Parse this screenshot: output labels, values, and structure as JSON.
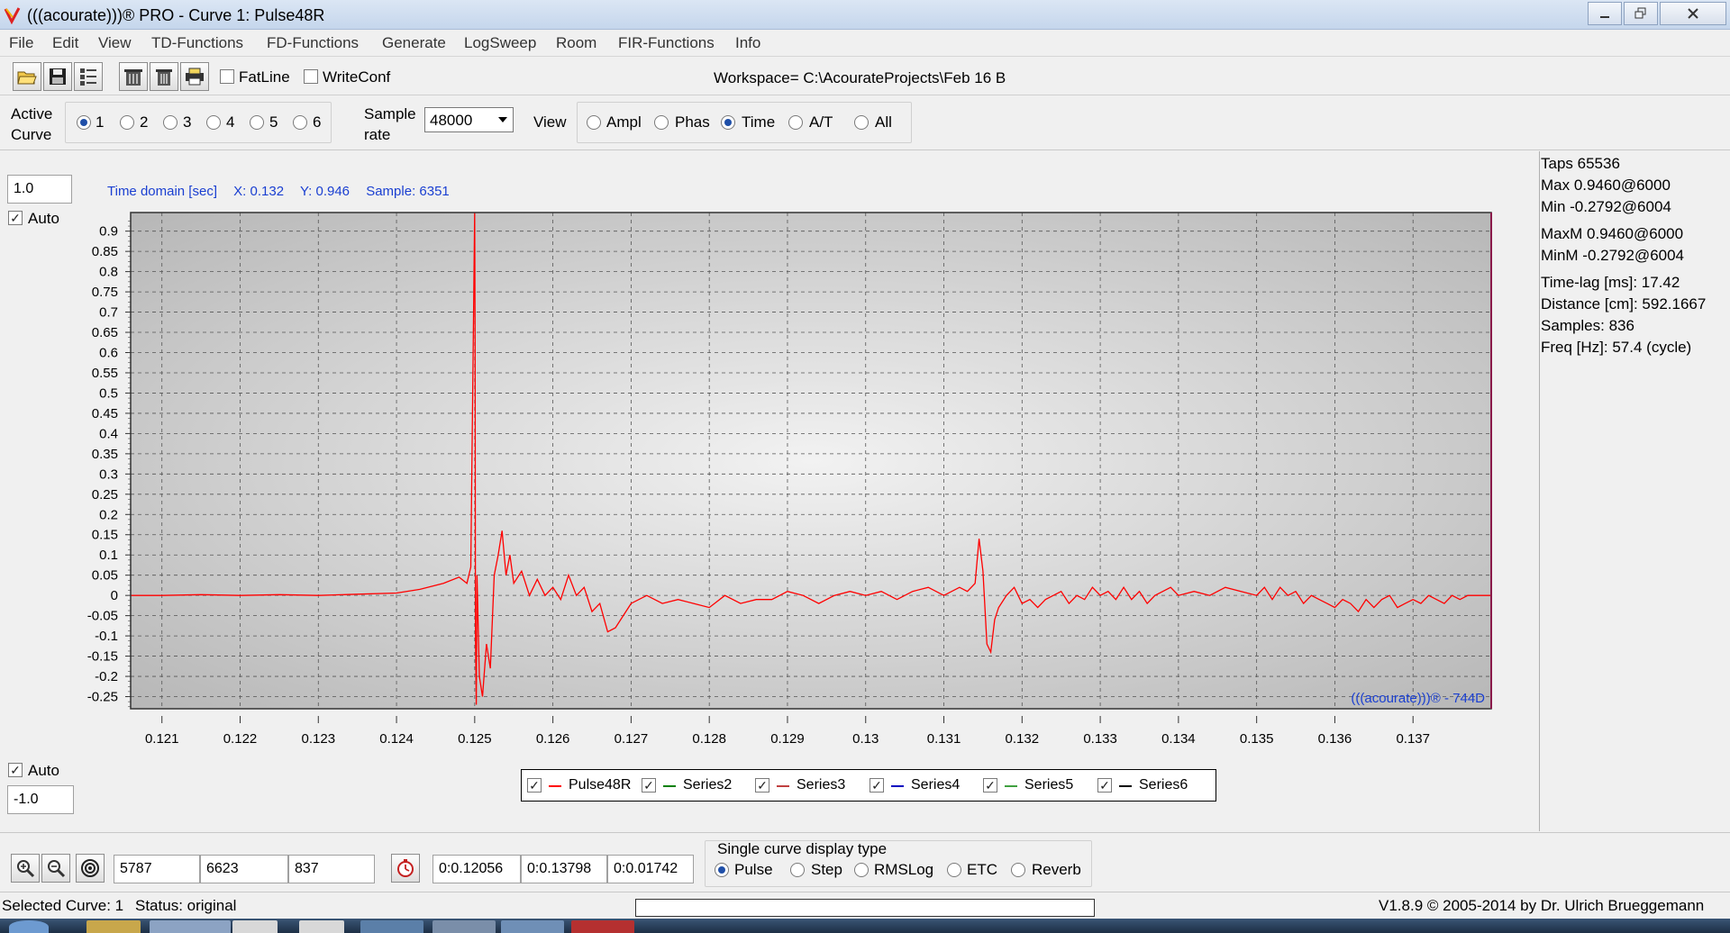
{
  "window": {
    "title": "(((acourate)))® PRO - Curve 1: Pulse48R"
  },
  "menu": [
    "File",
    "Edit",
    "View",
    "TD-Functions",
    "FD-Functions",
    "Generate",
    "LogSweep",
    "Room",
    "FIR-Functions",
    "Info"
  ],
  "toolbar": {
    "fatline_label": "FatLine",
    "writeconf_label": "WriteConf",
    "workspace": "Workspace=  C:\\AcourateProjects\\Feb 16 B"
  },
  "options": {
    "active_curve_label_1": "Active",
    "active_curve_label_2": "Curve",
    "curves": [
      "1",
      "2",
      "3",
      "4",
      "5",
      "6"
    ],
    "selected_curve": "1",
    "sample_rate_label_1": "Sample",
    "sample_rate_label_2": "rate",
    "sample_rate_value": "48000",
    "view_label": "View",
    "view_modes": [
      "Ampl",
      "Phas",
      "Time",
      "A/T",
      "All"
    ],
    "selected_view": "Time"
  },
  "chart_panel": {
    "ymax_input": "1.0",
    "ymin_input": "-1.0",
    "auto_label": "Auto",
    "header": {
      "domain": "Time domain [sec]",
      "x": "X: 0.132",
      "y": "Y: 0.946",
      "sample": "Sample: 6351"
    },
    "watermark": "(((acourate)))® - 744D"
  },
  "chart_data": {
    "type": "line",
    "title": "",
    "xlabel": "",
    "ylabel": "",
    "xlim": [
      0.1206,
      0.138
    ],
    "ylim": [
      -0.28,
      0.946
    ],
    "x_ticks": [
      "0.121",
      "0.122",
      "0.123",
      "0.124",
      "0.125",
      "0.126",
      "0.127",
      "0.128",
      "0.129",
      "0.13",
      "0.131",
      "0.132",
      "0.133",
      "0.134",
      "0.135",
      "0.136",
      "0.137"
    ],
    "y_ticks": [
      "0.9",
      "0.85",
      "0.8",
      "0.75",
      "0.7",
      "0.65",
      "0.6",
      "0.55",
      "0.5",
      "0.45",
      "0.4",
      "0.35",
      "0.3",
      "0.25",
      "0.2",
      "0.15",
      "0.1",
      "0.05",
      "0",
      "-0.05",
      "-0.1",
      "-0.15",
      "-0.2",
      "-0.25"
    ],
    "grid": true,
    "series": [
      {
        "name": "Pulse48R",
        "color": "#ff0000",
        "x": [
          0.1206,
          0.121,
          0.1215,
          0.122,
          0.1225,
          0.123,
          0.1235,
          0.124,
          0.1243,
          0.1246,
          0.1248,
          0.1249,
          0.12495,
          0.125,
          0.125005,
          0.12501,
          0.12502,
          0.12503,
          0.12506,
          0.1251,
          0.12515,
          0.1252,
          0.12525,
          0.1253,
          0.12535,
          0.1254,
          0.12545,
          0.1255,
          0.1256,
          0.1257,
          0.1258,
          0.1259,
          0.126,
          0.1261,
          0.1262,
          0.1263,
          0.1264,
          0.1265,
          0.1266,
          0.1267,
          0.1268,
          0.127,
          0.1272,
          0.1274,
          0.1276,
          0.1278,
          0.128,
          0.1282,
          0.1284,
          0.1286,
          0.1288,
          0.129,
          0.1292,
          0.1294,
          0.1296,
          0.1298,
          0.13,
          0.1302,
          0.1304,
          0.1306,
          0.1308,
          0.131,
          0.1312,
          0.1313,
          0.1314,
          0.13145,
          0.1315,
          0.13155,
          0.1316,
          0.13165,
          0.1317,
          0.1318,
          0.1319,
          0.132,
          0.1321,
          0.1322,
          0.1323,
          0.1324,
          0.1325,
          0.1326,
          0.1327,
          0.1328,
          0.1329,
          0.133,
          0.1331,
          0.1332,
          0.1333,
          0.1334,
          0.1335,
          0.1336,
          0.1337,
          0.1338,
          0.1339,
          0.134,
          0.1342,
          0.1344,
          0.1346,
          0.1348,
          0.135,
          0.1351,
          0.1352,
          0.1353,
          0.1354,
          0.1355,
          0.1356,
          0.1357,
          0.1358,
          0.1359,
          0.136,
          0.1361,
          0.1362,
          0.1363,
          0.1364,
          0.1365,
          0.1366,
          0.1367,
          0.1368,
          0.1369,
          0.137,
          0.1371,
          0.1372,
          0.1373,
          0.1374,
          0.1375,
          0.1376,
          0.1377,
          0.1378,
          0.138
        ],
        "y": [
          0,
          0.0,
          0.002,
          0.0,
          0.002,
          0.0,
          0.003,
          0.006,
          0.015,
          0.03,
          0.045,
          0.03,
          0.07,
          0.946,
          0.62,
          -0.1,
          -0.27,
          0.05,
          -0.2,
          -0.25,
          -0.12,
          -0.18,
          0.05,
          0.1,
          0.16,
          0.05,
          0.1,
          0.03,
          0.06,
          0.0,
          0.04,
          0.0,
          0.02,
          -0.01,
          0.05,
          0.0,
          0.02,
          -0.04,
          -0.02,
          -0.09,
          -0.08,
          -0.02,
          0.0,
          -0.02,
          -0.01,
          -0.02,
          -0.03,
          0.0,
          -0.02,
          -0.01,
          -0.01,
          0.01,
          0.0,
          -0.02,
          0.0,
          0.01,
          0.0,
          0.01,
          -0.01,
          0.01,
          0.02,
          0.0,
          0.02,
          0.01,
          0.03,
          0.14,
          0.06,
          -0.12,
          -0.14,
          -0.06,
          -0.03,
          0.0,
          0.02,
          -0.02,
          -0.01,
          -0.03,
          -0.01,
          0.0,
          0.01,
          -0.02,
          0.0,
          -0.01,
          0.02,
          0.0,
          0.01,
          -0.01,
          0.02,
          -0.01,
          0.01,
          -0.02,
          0.0,
          0.01,
          0.02,
          0.0,
          0.01,
          0.0,
          0.02,
          0.01,
          0.0,
          0.02,
          -0.01,
          0.02,
          0.0,
          0.01,
          -0.02,
          0.0,
          -0.01,
          -0.02,
          -0.03,
          -0.01,
          -0.02,
          -0.04,
          -0.01,
          -0.03,
          -0.01,
          0.0,
          -0.03,
          -0.02,
          -0.01,
          -0.02,
          0.0,
          -0.01,
          -0.02,
          0.0,
          -0.01,
          0.0,
          0.0,
          0.0
        ]
      }
    ],
    "legend": [
      {
        "name": "Pulse48R",
        "color": "#ff0000",
        "checked": true
      },
      {
        "name": "Series2",
        "color": "#008000",
        "checked": true
      },
      {
        "name": "Series3",
        "color": "#c04040",
        "checked": true
      },
      {
        "name": "Series4",
        "color": "#0000c0",
        "checked": true
      },
      {
        "name": "Series5",
        "color": "#40a040",
        "checked": true
      },
      {
        "name": "Series6",
        "color": "#000000",
        "checked": true
      }
    ]
  },
  "info": {
    "taps": "Taps 65536",
    "max": "Max 0.9460@6000",
    "min": "Min -0.2792@6004",
    "maxm": "MaxM 0.9460@6000",
    "minm": "MinM -0.2792@6004",
    "timelag": "Time-lag [ms]: 17.42",
    "distance": "Distance [cm]: 592.1667",
    "samples": "Samples:  836",
    "freq": "Freq [Hz]: 57.4 (cycle)"
  },
  "bottom": {
    "sample_from": "5787",
    "sample_to": "6623",
    "sample_count": "837",
    "time_from": "0:0.12056",
    "time_to": "0:0.13798",
    "time_span": "0:0.01742",
    "display_type_label": "Single curve display type",
    "display_types": [
      "Pulse",
      "Step",
      "RMSLog",
      "ETC",
      "Reverb"
    ],
    "selected_display_type": "Pulse"
  },
  "status": {
    "selected_curve": "Selected Curve: 1",
    "status": "Status: original",
    "version": "V1.8.9 © 2005-2014 by Dr. Ulrich Brueggemann"
  },
  "colors": {
    "plot_line": "#ff0000",
    "axis_border": "#7a1a1a",
    "header_text": "#1a3fd1"
  }
}
